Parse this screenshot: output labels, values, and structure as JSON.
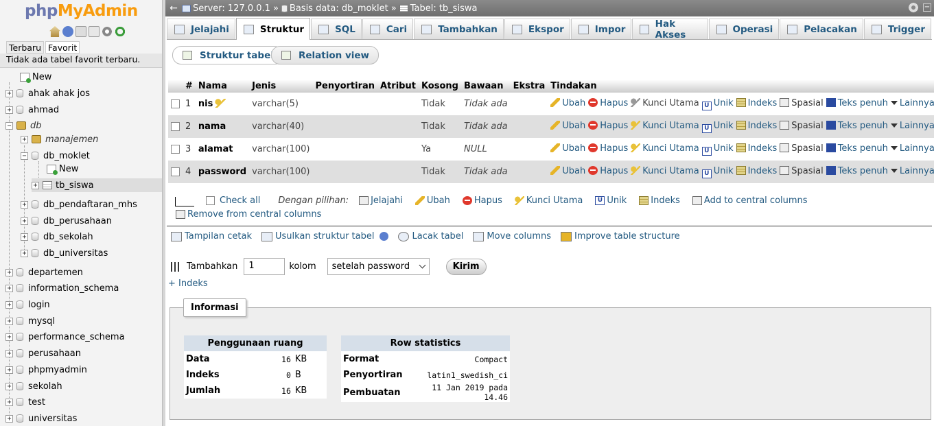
{
  "logo": {
    "php": "php",
    "my": "My",
    "admin": "Admin"
  },
  "nav": {
    "tabs": [
      "Terbaru",
      "Favorit"
    ],
    "favorite_note": "Tidak ada tabel favorit terbaru.",
    "tree": {
      "new_top": "New",
      "dbs_before": [
        "ahak ahak jos",
        "ahmad"
      ],
      "db_group": "db",
      "sub_group": "manajemen",
      "db_moklet": "db_moklet",
      "new_table": "New",
      "selected_table": "tb_siswa",
      "db_children": [
        "db_pendaftaran_mhs",
        "db_perusahaan",
        "db_sekolah",
        "db_universitas"
      ],
      "dbs_after": [
        "departemen",
        "information_schema",
        "login",
        "mysql",
        "performance_schema",
        "perusahaan",
        "phpmyadmin",
        "sekolah",
        "test",
        "universitas"
      ]
    }
  },
  "breadcrumb": {
    "server": "Server: 127.0.0.1",
    "database": "Basis data: db_moklet",
    "table": "Tabel: tb_siswa",
    "sep": "»"
  },
  "tabs": [
    {
      "label": "Jelajahi",
      "icon": "browse-icon"
    },
    {
      "label": "Struktur",
      "icon": "structure-icon",
      "active": true
    },
    {
      "label": "SQL",
      "icon": "sql-icon"
    },
    {
      "label": "Cari",
      "icon": "search-icon"
    },
    {
      "label": "Tambahkan",
      "icon": "insert-icon"
    },
    {
      "label": "Ekspor",
      "icon": "export-icon"
    },
    {
      "label": "Impor",
      "icon": "import-icon"
    },
    {
      "label": "Hak Akses",
      "icon": "privileges-icon"
    },
    {
      "label": "Operasi",
      "icon": "operations-icon"
    },
    {
      "label": "Pelacakan",
      "icon": "tracking-icon"
    },
    {
      "label": "Trigger",
      "icon": "trigger-icon"
    }
  ],
  "subtabs": {
    "structure": "Struktur tabel",
    "relation": "Relation view"
  },
  "table": {
    "headers": [
      "#",
      "Nama",
      "Jenis",
      "Penyortiran",
      "Atribut",
      "Kosong",
      "Bawaan",
      "Ekstra",
      "Tindakan"
    ],
    "rows": [
      {
        "num": "1",
        "name": "nis",
        "type": "varchar(5)",
        "null": "Tidak",
        "default": "Tidak ada",
        "primary": true
      },
      {
        "num": "2",
        "name": "nama",
        "type": "varchar(40)",
        "null": "Tidak",
        "default": "Tidak ada",
        "primary": false
      },
      {
        "num": "3",
        "name": "alamat",
        "type": "varchar(100)",
        "null": "Ya",
        "default": "NULL",
        "primary": false
      },
      {
        "num": "4",
        "name": "password",
        "type": "varchar(100)",
        "null": "Tidak",
        "default": "Tidak ada",
        "primary": false
      }
    ],
    "actions": {
      "change": "Ubah",
      "drop": "Hapus",
      "primary": "Kunci Utama",
      "unique": "Unik",
      "index": "Indeks",
      "spatial": "Spasial",
      "fulltext": "Teks penuh",
      "more": "Lainnya"
    }
  },
  "bulk": {
    "check_all": "Check all",
    "with_selected": "Dengan pilihan:",
    "browse": "Jelajahi",
    "change": "Ubah",
    "drop": "Hapus",
    "primary": "Kunci Utama",
    "unique": "Unik",
    "index": "Indeks",
    "add_central": "Add to central columns",
    "remove_central": "Remove from central columns"
  },
  "tools": {
    "print": "Tampilan cetak",
    "propose": "Usulkan struktur tabel",
    "track": "Lacak tabel",
    "move": "Move columns",
    "improve": "Improve table structure"
  },
  "add_columns": {
    "label": "Tambahkan",
    "count": "1",
    "unit": "kolom",
    "position": "setelah password",
    "submit": "Kirim"
  },
  "add_index": "+ Indeks",
  "info": {
    "legend": "Informasi",
    "space": {
      "title": "Penggunaan ruang",
      "rows": [
        {
          "label": "Data",
          "value": "16",
          "unit": "KB"
        },
        {
          "label": "Indeks",
          "value": "0",
          "unit": "B"
        },
        {
          "label": "Jumlah",
          "value": "16",
          "unit": "KB"
        }
      ]
    },
    "stats": {
      "title": "Row statistics",
      "rows": [
        {
          "label": "Format",
          "value": "Compact"
        },
        {
          "label": "Penyortiran",
          "value": "latin1_swedish_ci"
        },
        {
          "label": "Pembuatan",
          "value": "11 Jan 2019 pada 14.46"
        }
      ]
    }
  }
}
